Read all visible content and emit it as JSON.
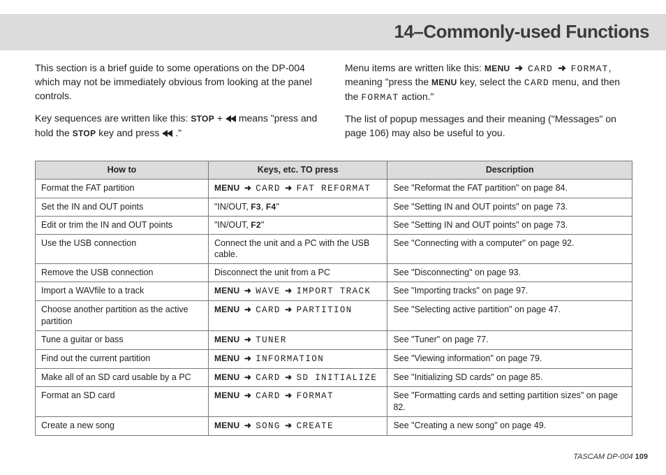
{
  "header": {
    "title": "14–Commonly-used Functions"
  },
  "intro": {
    "left": {
      "p1": "This section is a brief guide to some operations on the DP-004 which may not be immediately obvious from looking at the panel controls.",
      "p2_pre": "Key sequences are written like this: ",
      "p2_stop": "STOP",
      "p2_plus": " + ",
      "p2_means": " means ",
      "p2_hold": "\"press and hold the ",
      "p2_stop2": "STOP",
      "p2_and": " key and press ",
      "p2_end": ".\""
    },
    "right": {
      "p1_pre": "Menu items are written like this: ",
      "p1_menu": "MENU",
      "p1_card": "CARD",
      "p1_format": "FORMAT",
      "p1_mid": ", meaning \"press the ",
      "p1_menu2": "MENU",
      "p1_mid2": " key, select the ",
      "p1_card2": "CARD",
      "p1_mid3": " menu, and then the ",
      "p1_format2": "FORMAT",
      "p1_end": " action.\"",
      "p2": "The list of popup messages and their meaning (\"Messages\" on page 106) may also be useful to you."
    }
  },
  "table": {
    "head": {
      "c1": "How to",
      "c2": "Keys, etc. TO press",
      "c3": "Description"
    },
    "rows": [
      {
        "how": "Format the FAT partition",
        "keys": [
          {
            "k": "MENU"
          },
          {
            "a": 1
          },
          {
            "m": "CARD"
          },
          {
            "a": 1
          },
          {
            "m": "FAT REFORMAT"
          }
        ],
        "desc": "See \"Reformat the FAT partition\" on page 84."
      },
      {
        "how": "Set the IN and OUT points",
        "keys": [
          {
            "t": "\"IN/OUT, "
          },
          {
            "k": "F3"
          },
          {
            "t": ", "
          },
          {
            "k": "F4"
          },
          {
            "t": "\""
          }
        ],
        "desc": "See \"Setting IN and OUT points\" on page 73."
      },
      {
        "how": "Edit or trim the IN and OUT points",
        "keys": [
          {
            "t": "\"IN/OUT, "
          },
          {
            "k": "F2"
          },
          {
            "t": "\""
          }
        ],
        "desc": "See \"Setting IN and OUT points\" on page 73."
      },
      {
        "how": "Use the USB connection",
        "keys": [
          {
            "t": "Connect the unit and a PC with the USB cable."
          }
        ],
        "desc": "See \"Connecting with a computer\" on page 92."
      },
      {
        "how": "Remove the USB connection",
        "keys": [
          {
            "t": "Disconnect the unit from a PC"
          }
        ],
        "desc": "See \"Disconnecting\" on page 93."
      },
      {
        "how": "Import a WAVfile to a track",
        "keys": [
          {
            "k": "MENU"
          },
          {
            "a": 1
          },
          {
            "m": "WAVE"
          },
          {
            "a": 1
          },
          {
            "m": "IMPORT TRACK"
          }
        ],
        "desc": "See \"Importing tracks\" on page 97."
      },
      {
        "how": "Choose another partition as the active partition",
        "keys": [
          {
            "k": "MENU"
          },
          {
            "a": 1
          },
          {
            "m": "CARD"
          },
          {
            "a": 1
          },
          {
            "m": "PARTITION"
          }
        ],
        "desc": "See \"Selecting active partition\" on page 47."
      },
      {
        "how": "Tune a guitar or bass",
        "keys": [
          {
            "k": "MENU"
          },
          {
            "a": 1
          },
          {
            "m": "TUNER"
          }
        ],
        "desc": "See \"Tuner\" on page 77."
      },
      {
        "how": "Find out the current partition",
        "keys": [
          {
            "k": "MENU"
          },
          {
            "a": 1
          },
          {
            "m": "INFORMATION"
          }
        ],
        "desc": "See \"Viewing information\" on page 79."
      },
      {
        "how": "Make all of an SD card usable by a PC",
        "keys": [
          {
            "k": "MENU"
          },
          {
            "a": 1
          },
          {
            "m": "CARD"
          },
          {
            "a": 1
          },
          {
            "m": "SD INITIALIZE"
          }
        ],
        "desc": "See \"Initializing SD cards\" on page 85."
      },
      {
        "how": "Format an SD card",
        "keys": [
          {
            "k": "MENU"
          },
          {
            "a": 1
          },
          {
            "m": "CARD"
          },
          {
            "a": 1
          },
          {
            "m": "FORMAT"
          }
        ],
        "desc": "See \"Formatting cards and setting partition sizes\" on page 82."
      },
      {
        "how": "Create a new song",
        "keys": [
          {
            "k": "MENU"
          },
          {
            "a": 1
          },
          {
            "m": "SONG"
          },
          {
            "a": 1
          },
          {
            "m": "CREATE"
          }
        ],
        "desc": "See \"Creating a new song\" on page 49."
      }
    ]
  },
  "footer": {
    "brand": "TASCAM  DP-004 ",
    "page": "109"
  },
  "glyphs": {
    "arrow": "➜"
  }
}
